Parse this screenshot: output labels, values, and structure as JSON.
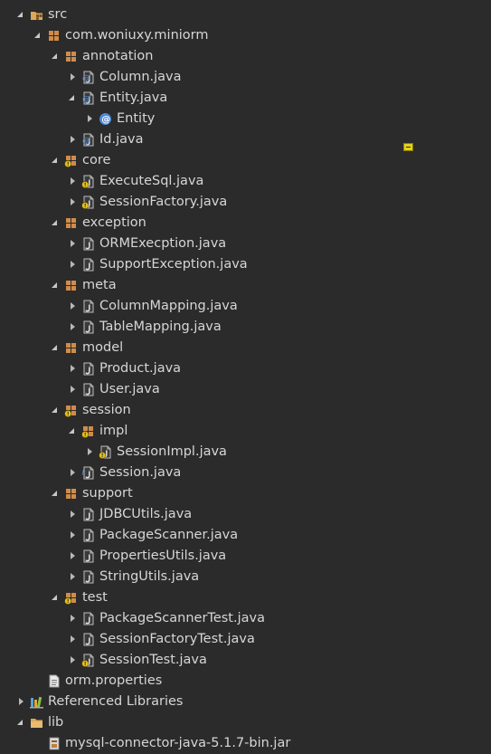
{
  "tree": [
    {
      "depth": 0,
      "toggle": "open",
      "icon": "source-folder-icon",
      "label": "src"
    },
    {
      "depth": 1,
      "toggle": "open",
      "icon": "package-icon",
      "label": "com.woniuxy.miniorm"
    },
    {
      "depth": 2,
      "toggle": "open",
      "icon": "package-icon",
      "label": "annotation"
    },
    {
      "depth": 3,
      "toggle": "closed",
      "icon": "annotation-file-icon",
      "label": "Column.java"
    },
    {
      "depth": 3,
      "toggle": "open",
      "icon": "annotation-file-icon",
      "label": "Entity.java"
    },
    {
      "depth": 4,
      "toggle": "closed",
      "icon": "annotation-type-icon",
      "label": "Entity"
    },
    {
      "depth": 3,
      "toggle": "closed",
      "icon": "annotation-file-icon",
      "label": "Id.java"
    },
    {
      "depth": 2,
      "toggle": "open",
      "icon": "package-warning-icon",
      "label": "core"
    },
    {
      "depth": 3,
      "toggle": "closed",
      "icon": "java-file-warning-icon",
      "label": "ExecuteSql.java"
    },
    {
      "depth": 3,
      "toggle": "closed",
      "icon": "java-file-warning-icon",
      "label": "SessionFactory.java"
    },
    {
      "depth": 2,
      "toggle": "open",
      "icon": "package-icon",
      "label": "exception"
    },
    {
      "depth": 3,
      "toggle": "closed",
      "icon": "java-file-icon",
      "label": "ORMExecption.java"
    },
    {
      "depth": 3,
      "toggle": "closed",
      "icon": "java-file-icon",
      "label": "SupportException.java"
    },
    {
      "depth": 2,
      "toggle": "open",
      "icon": "package-icon",
      "label": "meta"
    },
    {
      "depth": 3,
      "toggle": "closed",
      "icon": "java-file-icon",
      "label": "ColumnMapping.java"
    },
    {
      "depth": 3,
      "toggle": "closed",
      "icon": "java-file-icon",
      "label": "TableMapping.java"
    },
    {
      "depth": 2,
      "toggle": "open",
      "icon": "package-icon",
      "label": "model"
    },
    {
      "depth": 3,
      "toggle": "closed",
      "icon": "java-file-icon",
      "label": "Product.java"
    },
    {
      "depth": 3,
      "toggle": "closed",
      "icon": "java-file-icon",
      "label": "User.java"
    },
    {
      "depth": 2,
      "toggle": "open",
      "icon": "package-warning-icon",
      "label": "session"
    },
    {
      "depth": 3,
      "toggle": "open",
      "icon": "package-warning-icon",
      "label": "impl"
    },
    {
      "depth": 4,
      "toggle": "closed",
      "icon": "java-file-warning-icon",
      "label": "SessionImpl.java"
    },
    {
      "depth": 3,
      "toggle": "closed",
      "icon": "interface-file-icon",
      "label": "Session.java"
    },
    {
      "depth": 2,
      "toggle": "open",
      "icon": "package-icon",
      "label": "support"
    },
    {
      "depth": 3,
      "toggle": "closed",
      "icon": "java-file-icon",
      "label": "JDBCUtils.java"
    },
    {
      "depth": 3,
      "toggle": "closed",
      "icon": "java-file-icon",
      "label": "PackageScanner.java"
    },
    {
      "depth": 3,
      "toggle": "closed",
      "icon": "java-file-icon",
      "label": "PropertiesUtils.java"
    },
    {
      "depth": 3,
      "toggle": "closed",
      "icon": "java-file-icon",
      "label": "StringUtils.java"
    },
    {
      "depth": 2,
      "toggle": "open",
      "icon": "package-warning-icon",
      "label": "test"
    },
    {
      "depth": 3,
      "toggle": "closed",
      "icon": "java-file-icon",
      "label": "PackageScannerTest.java"
    },
    {
      "depth": 3,
      "toggle": "closed",
      "icon": "java-file-icon",
      "label": "SessionFactoryTest.java"
    },
    {
      "depth": 3,
      "toggle": "closed",
      "icon": "java-file-warning-icon",
      "label": "SessionTest.java"
    },
    {
      "depth": 1,
      "toggle": "none",
      "icon": "properties-file-icon",
      "label": "orm.properties"
    },
    {
      "depth": 0,
      "toggle": "closed",
      "icon": "library-icon",
      "label": "Referenced Libraries"
    },
    {
      "depth": 0,
      "toggle": "open",
      "icon": "folder-icon",
      "label": "lib"
    },
    {
      "depth": 1,
      "toggle": "none",
      "icon": "jar-file-icon",
      "label": "mysql-connector-java-5.1.7-bin.jar"
    }
  ],
  "colors": {
    "background": "#2b2b2b",
    "text": "#d6d6d6",
    "folder": "#d9a85b",
    "package": "#d08c4a",
    "java_j": "#e0e0e0",
    "annotation": "#4a8ad8",
    "warning": "#e8c21c",
    "marker": "#e4d21b"
  }
}
